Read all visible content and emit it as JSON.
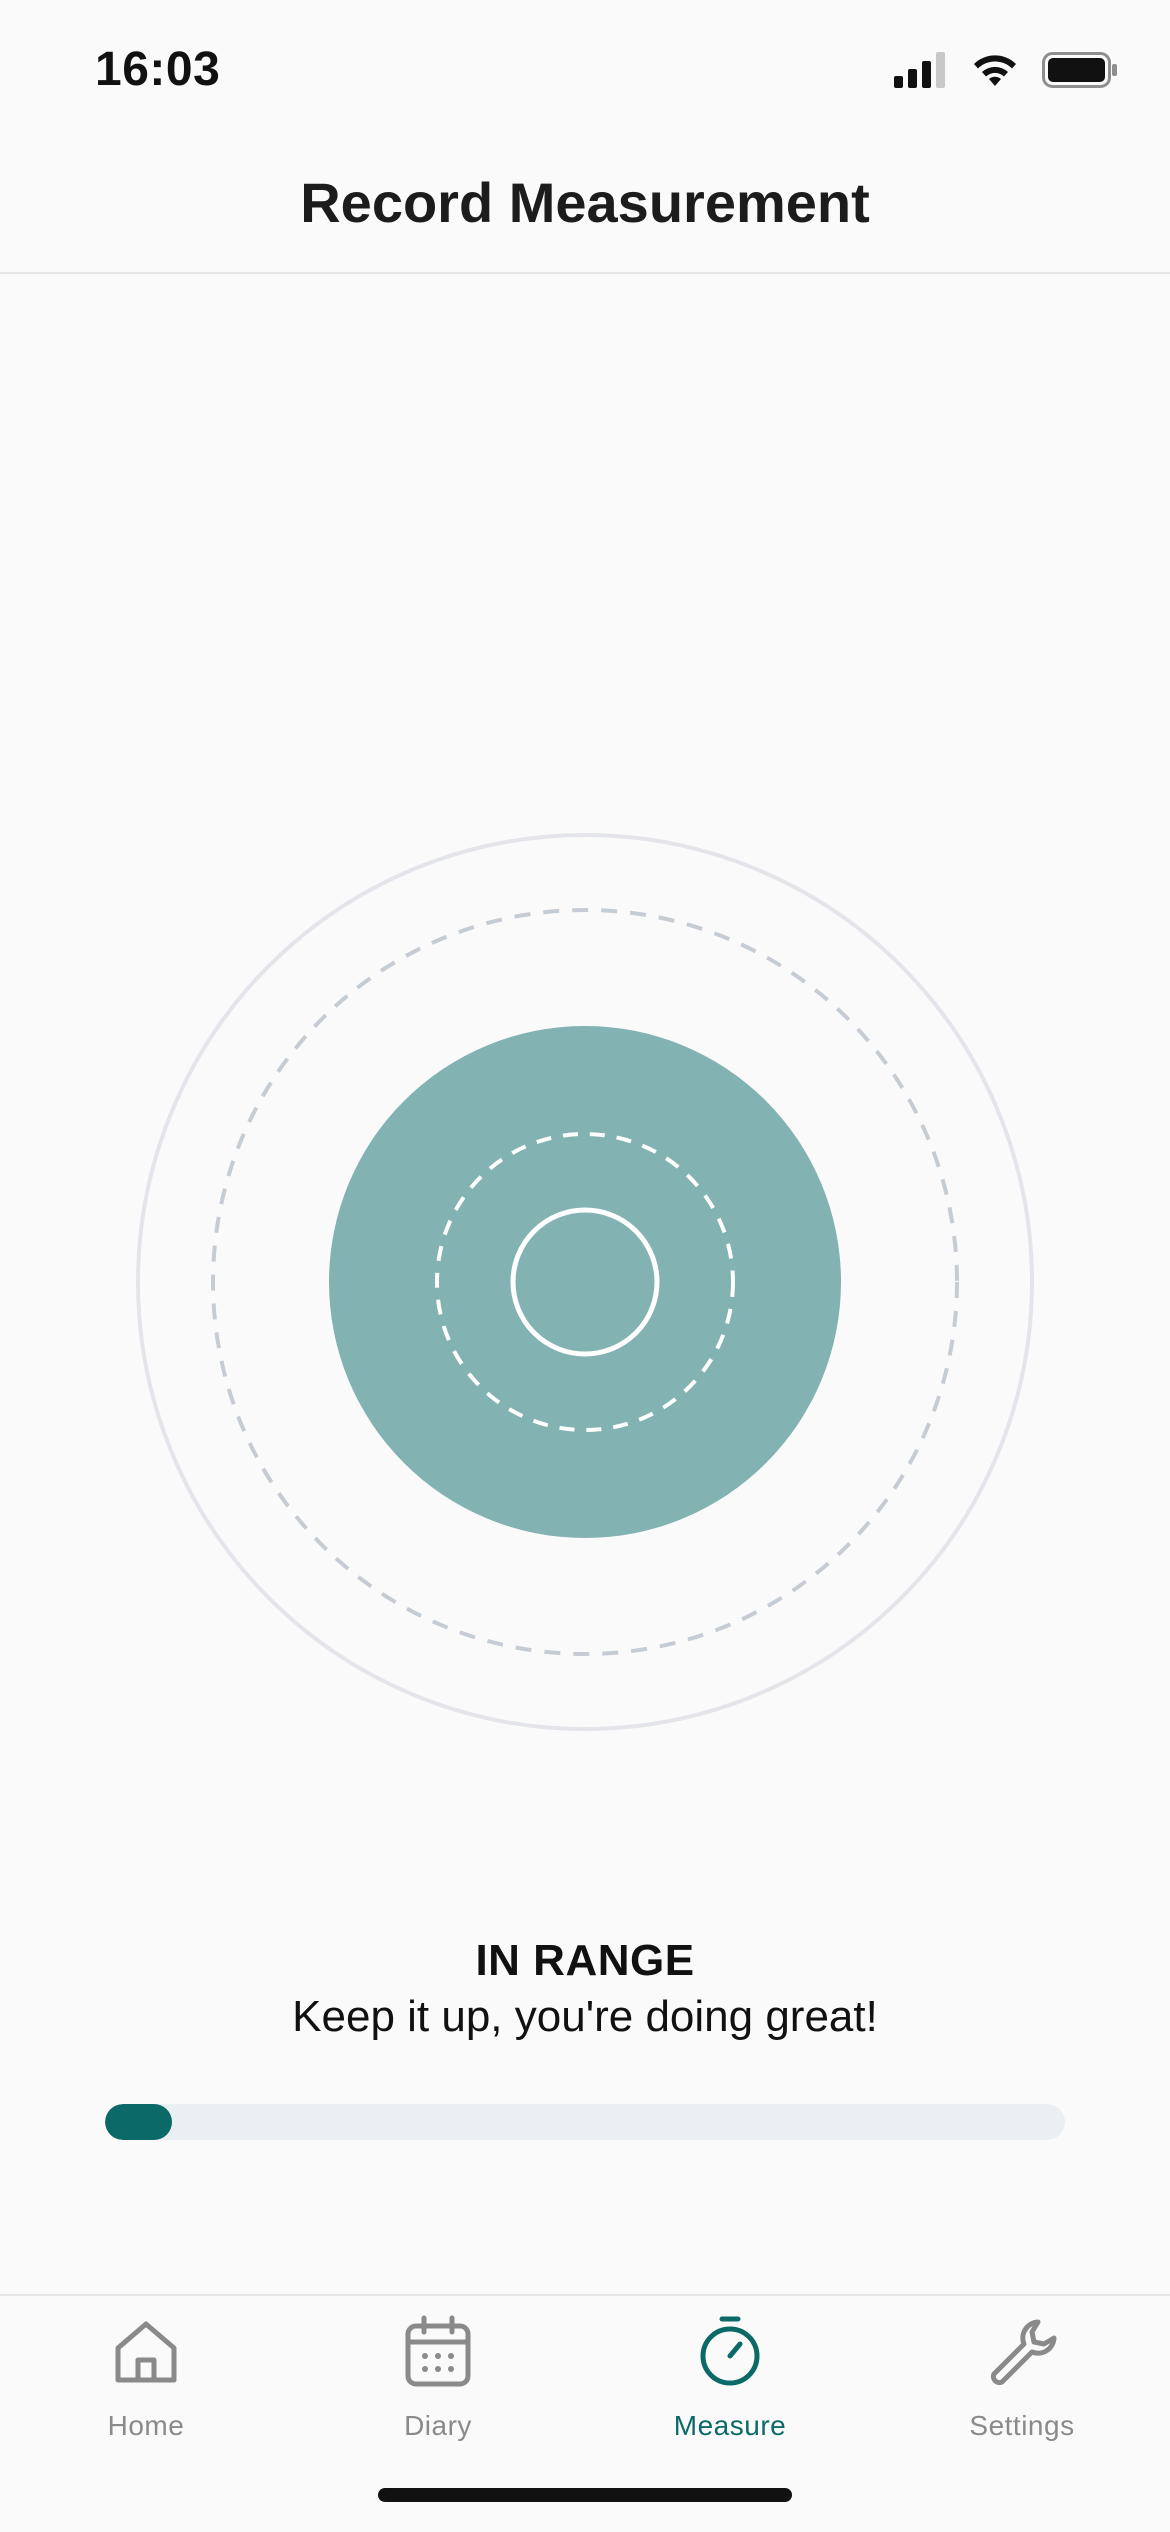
{
  "status_bar": {
    "time": "16:03",
    "signal_icon": "cellular-signal-icon",
    "wifi_icon": "wifi-icon",
    "battery_icon": "battery-icon"
  },
  "header": {
    "title": "Record Measurement"
  },
  "measurement": {
    "status": "IN RANGE",
    "message": "Keep it up, you're doing great!",
    "progress_fraction": 0.07
  },
  "colors": {
    "accent": "#0b6a68",
    "target_fill": "#82b2b1",
    "outer_ring": "#e3e5ea",
    "dashed_ring": "#c6ccd3",
    "inactive_tab": "#8a8a8a"
  },
  "tabs": [
    {
      "label": "Home",
      "icon": "home-icon",
      "active": false
    },
    {
      "label": "Diary",
      "icon": "calendar-icon",
      "active": false
    },
    {
      "label": "Measure",
      "icon": "stopwatch-icon",
      "active": true
    },
    {
      "label": "Settings",
      "icon": "wrench-icon",
      "active": false
    }
  ]
}
